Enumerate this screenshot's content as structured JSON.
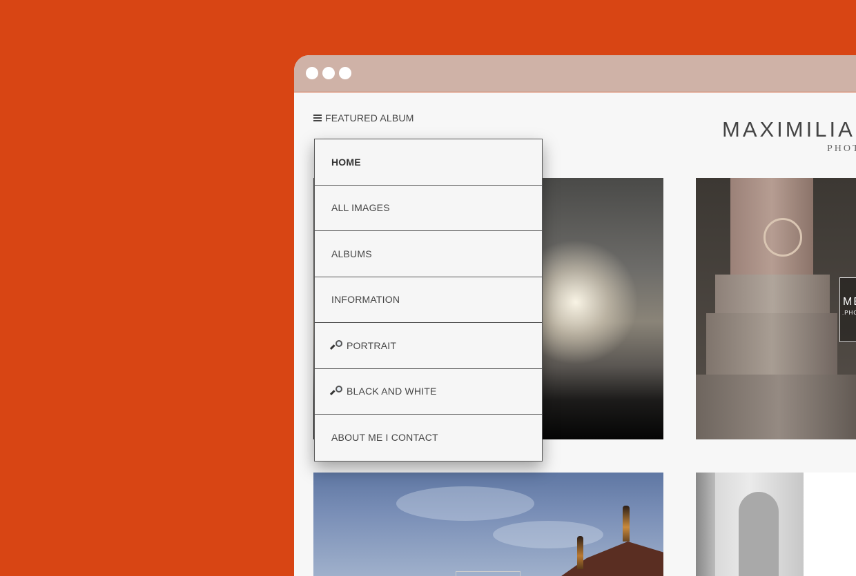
{
  "nav": {
    "toggle_label": "FEATURED ALBUM",
    "items": [
      {
        "label": "HOME",
        "active": true,
        "icon": null
      },
      {
        "label": "ALL IMAGES",
        "icon": null
      },
      {
        "label": "ALBUMS",
        "icon": null
      },
      {
        "label": "INFORMATION",
        "icon": null
      },
      {
        "label": "PORTRAIT",
        "icon": "magnifier-icon"
      },
      {
        "label": "BLACK AND WHITE",
        "icon": "magnifier-icon"
      },
      {
        "label": "ABOUT ME I CONTACT",
        "icon": null
      }
    ]
  },
  "site": {
    "name": "MAXIMILIAN",
    "subtitle": "PHOT"
  },
  "thumb_badge": {
    "text": "ME",
    "sub": ".PHO"
  },
  "colors": {
    "background": "#d84514",
    "titlebar": "#cfb2a7",
    "page": "#f7f7f7",
    "menu_border": "#555555"
  }
}
